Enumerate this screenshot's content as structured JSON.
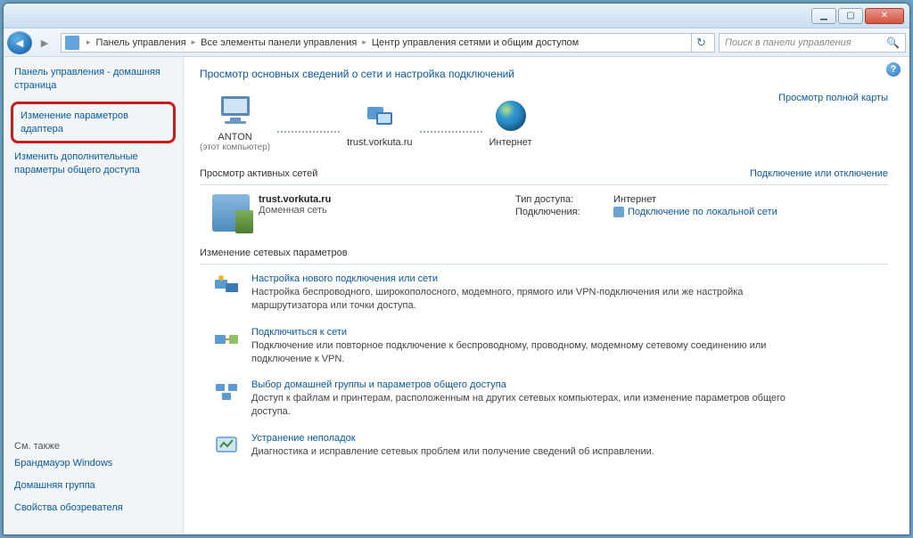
{
  "breadcrumb": {
    "b1": "Панель управления",
    "b2": "Все элементы панели управления",
    "b3": "Центр управления сетями и общим доступом"
  },
  "search": {
    "placeholder": "Поиск в панели управления"
  },
  "sidebar": {
    "home": "Панель управления - домашняя страница",
    "adapter": "Изменение параметров адаптера",
    "sharing": "Изменить дополнительные параметры общего доступа",
    "footer_head": "См. также",
    "f1": "Брандмауэр Windows",
    "f2": "Домашняя группа",
    "f3": "Свойства обозревателя"
  },
  "main": {
    "title": "Просмотр основных сведений о сети и настройка подключений",
    "map_full": "Просмотр полной карты",
    "node1": "ANTON",
    "node1_sub": "(этот компьютер)",
    "node2": "trust.vorkuta.ru",
    "node3": "Интернет",
    "sect_active": "Просмотр активных сетей",
    "sect_active_link": "Подключение или отключение",
    "net_name": "trust.vorkuta.ru",
    "net_type": "Доменная сеть",
    "access_lbl": "Тип доступа:",
    "access_val": "Интернет",
    "conn_lbl": "Подключения:",
    "conn_val": "Подключение по локальной сети",
    "sect_change": "Изменение сетевых параметров",
    "opt1_t": "Настройка нового подключения или сети",
    "opt1_d": "Настройка беспроводного, широкополосного, модемного, прямого или VPN-подключения или же настройка маршрутизатора или точки доступа.",
    "opt2_t": "Подключиться к сети",
    "opt2_d": "Подключение или повторное подключение к беспроводному, проводному, модемному сетевому соединению или подключение к VPN.",
    "opt3_t": "Выбор домашней группы и параметров общего доступа",
    "opt3_d": "Доступ к файлам и принтерам, расположенным на других сетевых компьютерах, или изменение параметров общего доступа.",
    "opt4_t": "Устранение неполадок",
    "opt4_d": "Диагностика и исправление сетевых проблем или получение сведений об исправлении."
  }
}
